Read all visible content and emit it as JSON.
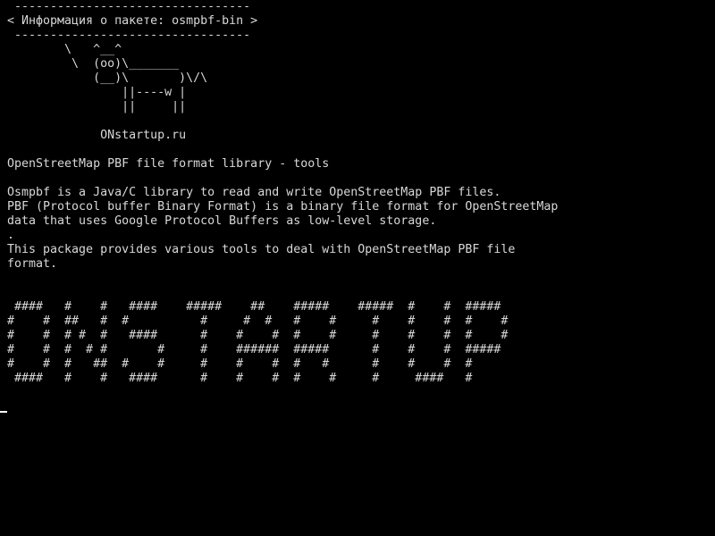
{
  "colors": {
    "background": "#000000",
    "foreground": "#d8d8d8",
    "cursor": "#ffffff"
  },
  "terminal": {
    "lines": [
      " ---------------------------------",
      "< Информация о пакете: osmpbf-bin >",
      " ---------------------------------",
      "        \\   ^__^",
      "         \\  (oo)\\_______",
      "            (__)\\       )\\/\\",
      "                ||----w |",
      "                ||     ||",
      "",
      "             ONstartup.ru",
      "",
      "OpenStreetMap PBF file format library - tools",
      "",
      "Osmpbf is a Java/C library to read and write OpenStreetMap PBF files.",
      "PBF (Protocol buffer Binary Format) is a binary file format for OpenStreetMap",
      "data that uses Google Protocol Buffers as low-level storage.",
      ".",
      "This package provides various tools to deal with OpenStreetMap PBF file",
      "format.",
      "",
      "",
      " ####   #    #   ####    #####    ##    #####    #####  #    #  #####",
      "#    #  ##   #  #          #     #  #   #    #     #    #    #  #    #",
      "#    #  # #  #   ####      #    #    #  #    #     #    #    #  #    #",
      "#    #  #  # #       #     #    ######  #####      #    #    #  #####",
      "#    #  #   ##  #    #     #    #    #  #   #      #    #    #  #",
      " ####   #    #   ####      #    #    #  #    #     #     ####   #"
    ]
  }
}
